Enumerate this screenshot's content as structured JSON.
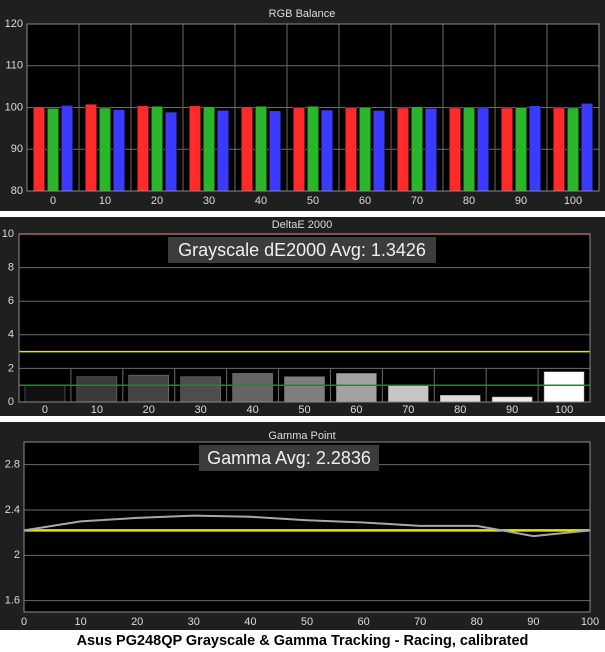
{
  "caption": "Asus PG248QP Grayscale & Gamma Tracking - Racing, calibrated",
  "colors": {
    "panel_bg": "#1f1f1f",
    "plot_bg": "#000000",
    "grid": "#6a6a6a",
    "text": "#dcdcdc",
    "red": "#ff2b2b",
    "green": "#2bb52b",
    "blue": "#3b3bff",
    "reference_yellow": "#e6e600",
    "reference_green": "#169016",
    "reference_red": "#e02020",
    "gamma_line": "#a8a8a8"
  },
  "chart_data": [
    {
      "type": "bar",
      "title": "RGB Balance",
      "categories": [
        "0",
        "10",
        "20",
        "30",
        "40",
        "50",
        "60",
        "70",
        "80",
        "90",
        "100"
      ],
      "ylim": [
        80,
        120
      ],
      "yticks": [
        80,
        90,
        100,
        110,
        120
      ],
      "series": [
        {
          "name": "Red",
          "color": "red",
          "values": [
            100.2,
            100.8,
            100.4,
            100.4,
            100.2,
            100.0,
            100.0,
            99.9,
            99.9,
            99.9,
            99.9
          ]
        },
        {
          "name": "Green",
          "color": "green",
          "values": [
            99.8,
            99.9,
            100.3,
            100.2,
            100.3,
            100.3,
            100.1,
            100.2,
            100.1,
            100.0,
            99.9
          ]
        },
        {
          "name": "Blue",
          "color": "blue",
          "values": [
            100.5,
            99.5,
            98.9,
            99.3,
            99.2,
            99.4,
            99.3,
            99.8,
            99.9,
            100.4,
            101.0
          ]
        }
      ],
      "grid": true
    },
    {
      "type": "bar",
      "title": "DeltaE 2000",
      "annotation": "Grayscale dE2000 Avg: 1.3426",
      "categories": [
        "0",
        "10",
        "20",
        "30",
        "40",
        "50",
        "60",
        "70",
        "80",
        "90",
        "100"
      ],
      "values": [
        1.0,
        1.5,
        1.6,
        1.5,
        1.7,
        1.5,
        1.7,
        1.0,
        0.4,
        0.3,
        1.8
      ],
      "bar_grays": [
        "#111111",
        "#3a3a3a",
        "#444444",
        "#4e4e4e",
        "#656565",
        "#7f7f7f",
        "#a2a2a2",
        "#c6c6c6",
        "#dcdcdc",
        "#ececec",
        "#ffffff"
      ],
      "ylim": [
        0,
        10
      ],
      "yticks": [
        0,
        2,
        4,
        6,
        8,
        10
      ],
      "reference_lines": [
        {
          "value": 10,
          "color": "reference_red"
        },
        {
          "value": 3,
          "color": "reference_yellow"
        },
        {
          "value": 1,
          "color": "reference_green"
        }
      ],
      "grid": true
    },
    {
      "type": "line",
      "title": "Gamma Point",
      "annotation": "Gamma Avg: 2.2836",
      "x": [
        0,
        10,
        20,
        30,
        40,
        50,
        60,
        70,
        80,
        90,
        100
      ],
      "y": [
        2.22,
        2.3,
        2.33,
        2.35,
        2.34,
        2.31,
        2.29,
        2.26,
        2.26,
        2.17,
        2.22
      ],
      "reference": 2.22,
      "xlim": [
        0,
        100
      ],
      "ylim": [
        1.5,
        3.0
      ],
      "xticks": [
        0,
        10,
        20,
        30,
        40,
        50,
        60,
        70,
        80,
        90,
        100
      ],
      "yticks": [
        1.6,
        2,
        2.4,
        2.8
      ],
      "grid": true
    }
  ]
}
